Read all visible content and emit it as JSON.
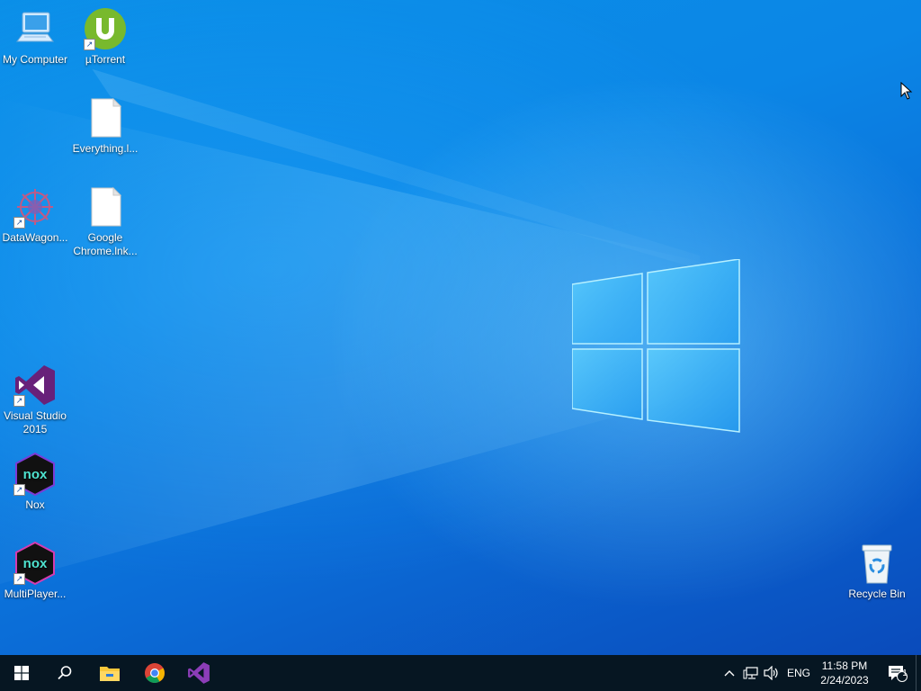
{
  "desktop": {
    "icons": [
      {
        "name": "my-computer",
        "label": "My Computer",
        "shortcut": false,
        "icon": "computer-icon"
      },
      {
        "name": "utorrent",
        "label": "µTorrent",
        "shortcut": true,
        "icon": "utorrent-icon"
      },
      {
        "name": "everything",
        "label": "Everything.l...",
        "shortcut": false,
        "icon": "file-icon"
      },
      {
        "name": "datawagon",
        "label": "DataWagon...",
        "shortcut": true,
        "icon": "datawagon-icon"
      },
      {
        "name": "google-chrome-lnk",
        "label": "Google Chrome.lnk...",
        "shortcut": false,
        "icon": "file-icon"
      },
      {
        "name": "visual-studio",
        "label": "Visual Studio 2015",
        "shortcut": true,
        "icon": "visual-studio-icon"
      },
      {
        "name": "nox",
        "label": "Nox",
        "shortcut": true,
        "icon": "nox-icon"
      },
      {
        "name": "multiplayer",
        "label": "MultiPlayer...",
        "shortcut": true,
        "icon": "nox-multiplayer-icon"
      },
      {
        "name": "recycle-bin",
        "label": "Recycle Bin",
        "shortcut": false,
        "icon": "recycle-bin-icon"
      }
    ]
  },
  "taskbar": {
    "pinned": [
      {
        "name": "start-button",
        "icon": "windows-start-icon"
      },
      {
        "name": "search-button",
        "icon": "search-icon"
      },
      {
        "name": "file-explorer-button",
        "icon": "folder-icon"
      },
      {
        "name": "chrome-button",
        "icon": "chrome-icon"
      },
      {
        "name": "visual-studio-button",
        "icon": "visual-studio-icon"
      }
    ],
    "tray": {
      "language": "ENG",
      "time": "11:58 PM",
      "date": "2/24/2023",
      "notification_count": "1"
    }
  },
  "colors": {
    "taskbar_bg": "#061622",
    "desktop_blue": "#0b86e6",
    "vs_purple": "#68217a"
  }
}
